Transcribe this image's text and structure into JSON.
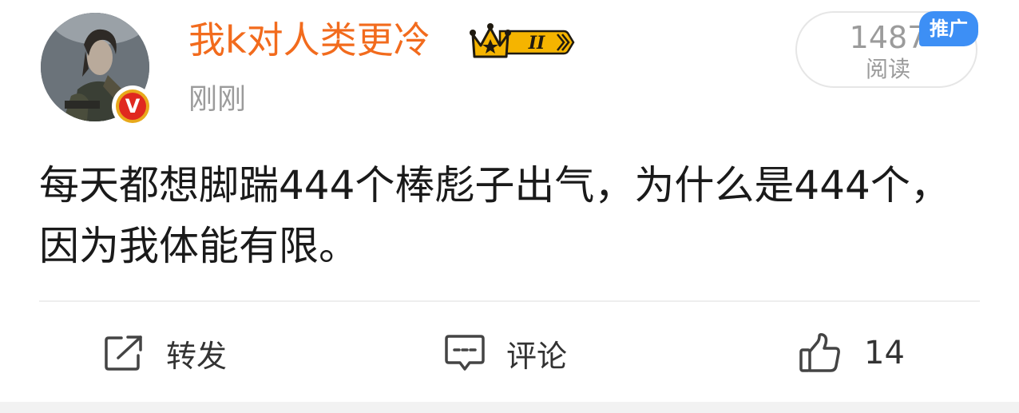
{
  "post": {
    "author": {
      "name": "我k对人类更冷",
      "verified_mark": "V",
      "vip_level": "II"
    },
    "timestamp": "刚刚",
    "read_counter": {
      "count": "1487",
      "label": "阅读",
      "promo_badge": "推广"
    },
    "content": "每天都想脚踹444个棒彪子出气，为什么是444个，因为我体能有限。",
    "actions": {
      "repost": {
        "label": "转发",
        "icon": "share-icon"
      },
      "comment": {
        "label": "评论",
        "icon": "comment-icon"
      },
      "like": {
        "count": "14",
        "icon": "thumbs-up-icon"
      }
    }
  },
  "colors": {
    "username": "#f26b1d",
    "secondary_text": "#9b9b9b",
    "promo_badge": "#3d8ff5",
    "verified_red": "#e0291f",
    "verified_gold": "#e8a91b",
    "vip_gold": "#f5b400"
  }
}
